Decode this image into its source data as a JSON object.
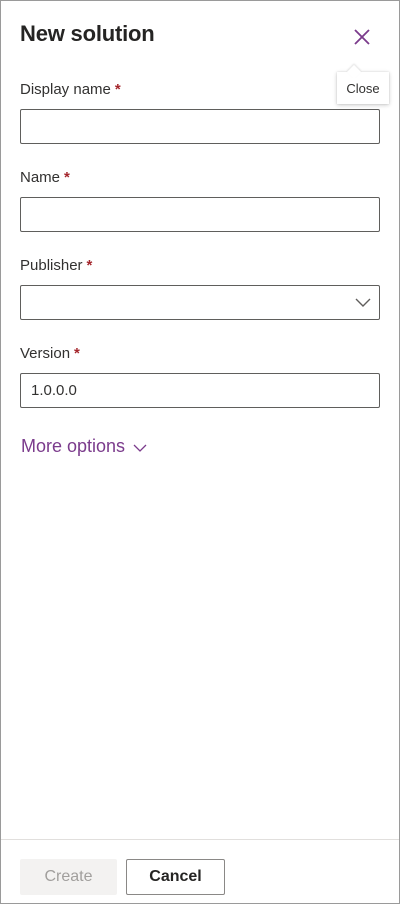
{
  "panel": {
    "title": "New solution",
    "close_tooltip": "Close"
  },
  "fields": {
    "display_name": {
      "label": "Display name",
      "required_marker": "*",
      "value": ""
    },
    "name": {
      "label": "Name",
      "required_marker": "*",
      "value": ""
    },
    "publisher": {
      "label": "Publisher",
      "required_marker": "*",
      "value": ""
    },
    "version": {
      "label": "Version",
      "required_marker": "*",
      "value": "1.0.0.0"
    }
  },
  "more_options": {
    "label": "More options"
  },
  "footer": {
    "create_label": "Create",
    "cancel_label": "Cancel"
  },
  "colors": {
    "accent": "#7b3b8c",
    "required": "#a4262c",
    "disabled_bg": "#f3f2f1",
    "disabled_text": "#a19f9d"
  },
  "icons": {
    "close": "close-icon",
    "publisher_dropdown": "chevron-down-icon",
    "more_options": "chevron-down-icon"
  }
}
